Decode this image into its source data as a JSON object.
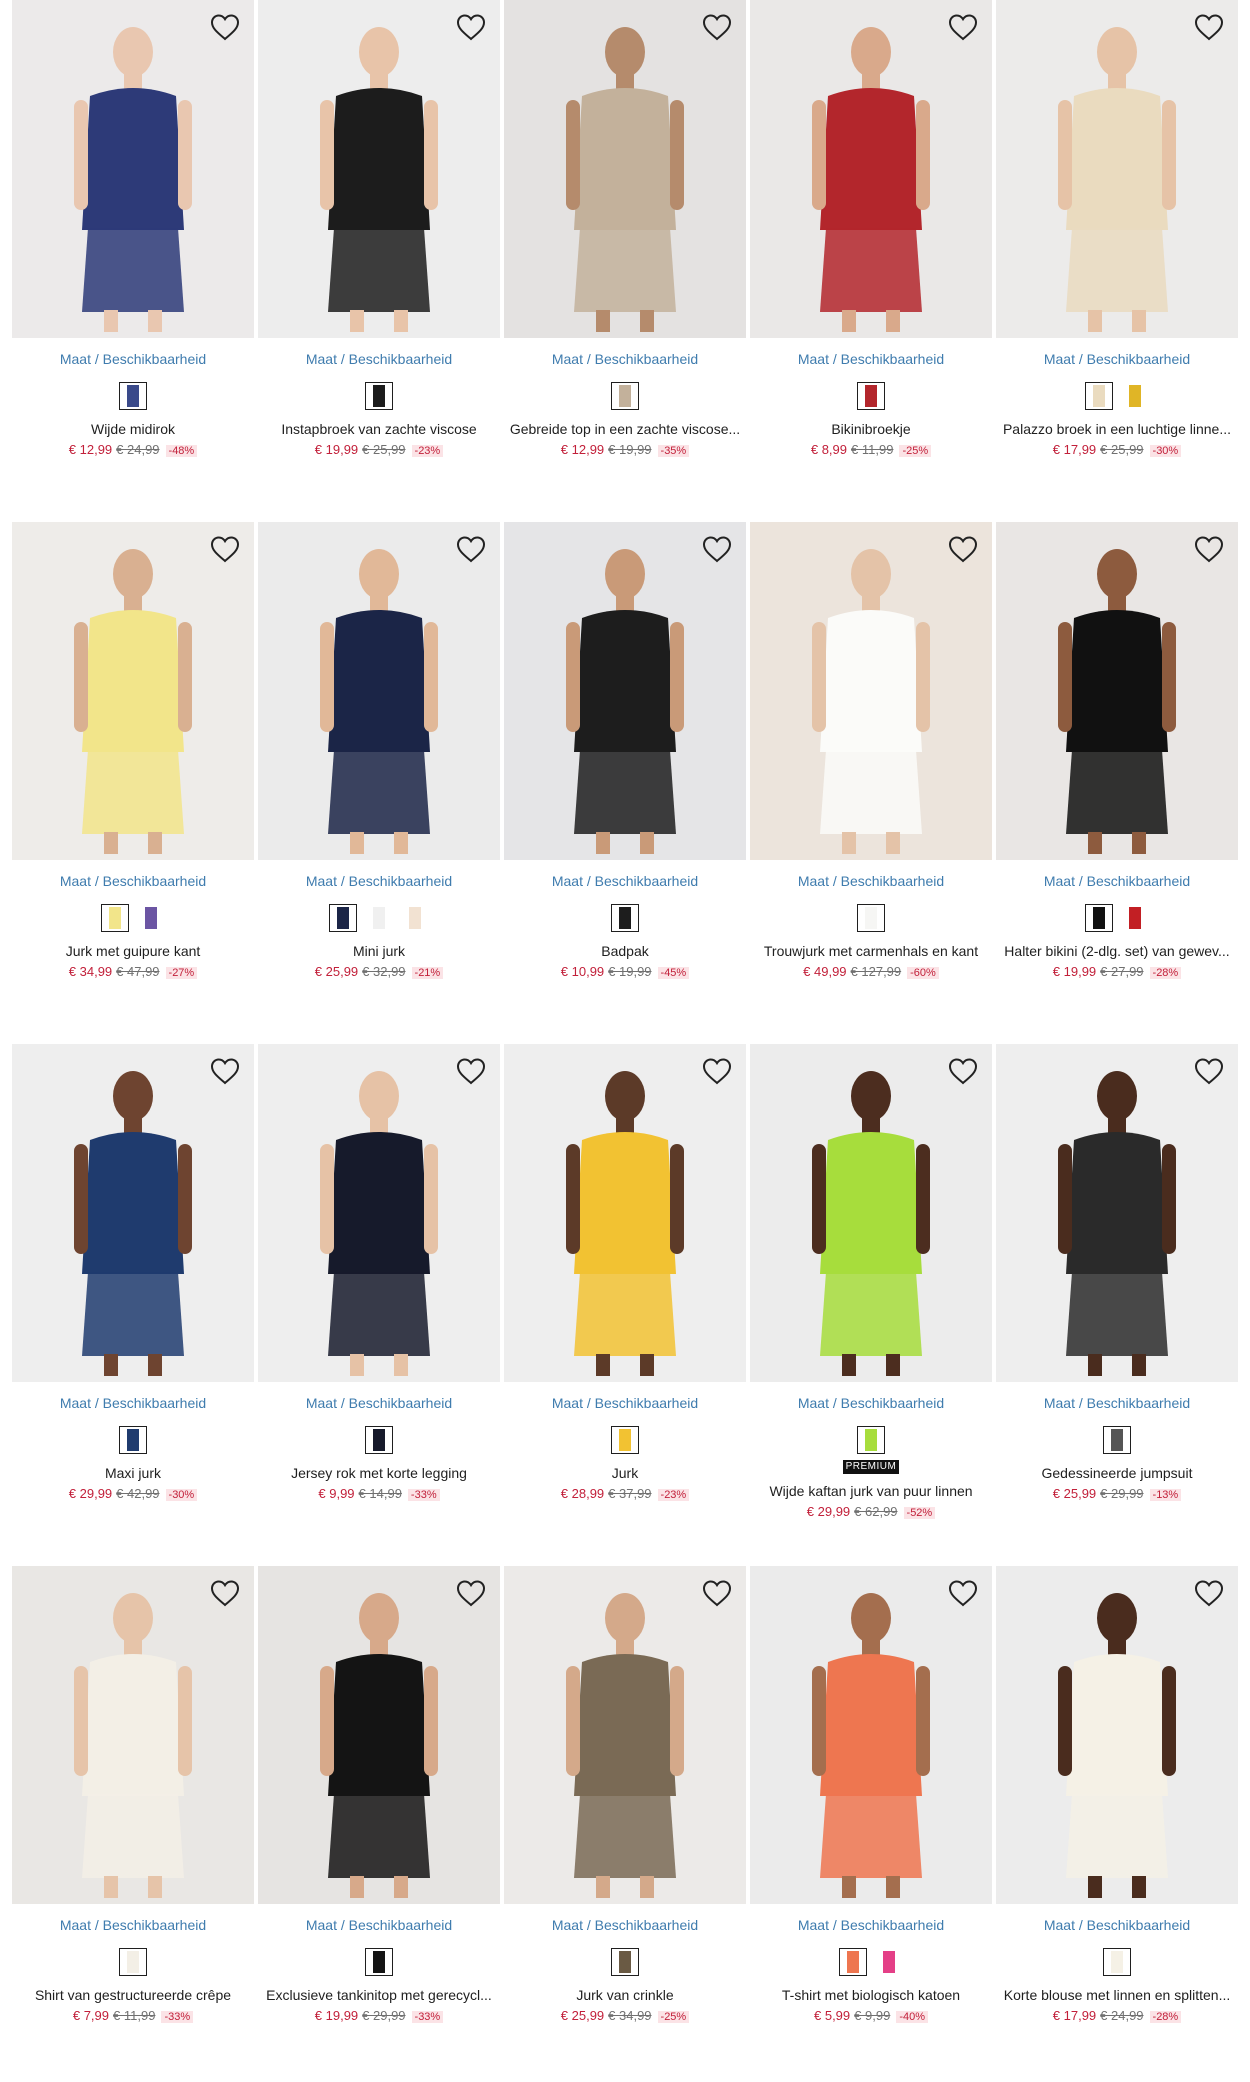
{
  "availability_label": "Maat / Beschikbaarheid",
  "premium_label": "PREMIUM",
  "products": [
    {
      "name": "Wijde midirok",
      "price": "€ 12,99",
      "old_price": "€ 24,99",
      "discount": "-48%",
      "bg": "#eceaea",
      "fig": "#2d3a78",
      "skin": "#e9c7b0",
      "swatches": [
        "#3a4a8a"
      ]
    },
    {
      "name": "Instapbroek van zachte viscose",
      "price": "€ 19,99",
      "old_price": "€ 25,99",
      "discount": "-23%",
      "bg": "#ededed",
      "fig": "#1c1c1c",
      "skin": "#e8c4a9",
      "swatches": [
        "#1c1c1c"
      ]
    },
    {
      "name": "Gebreide top in een zachte viscose...",
      "price": "€ 12,99",
      "old_price": "€ 19,99",
      "discount": "-35%",
      "bg": "#e4e2e1",
      "fig": "#c3b19b",
      "skin": "#b58b6c",
      "swatches": [
        "#c3b19b"
      ]
    },
    {
      "name": "Bikinibroekje",
      "price": "€ 8,99",
      "old_price": "€ 11,99",
      "discount": "-25%",
      "bg": "#eae8e7",
      "fig": "#b3262c",
      "skin": "#d9a98b",
      "swatches": [
        "#b3262c"
      ]
    },
    {
      "name": "Palazzo broek in een luchtige linne...",
      "price": "€ 17,99",
      "old_price": "€ 25,99",
      "discount": "-30%",
      "bg": "#ecebea",
      "fig": "#eadbbf",
      "skin": "#e6c3a7",
      "swatches": [
        "#eadbbf",
        "#e0b526"
      ]
    },
    {
      "name": "Jurk met guipure kant",
      "price": "€ 34,99",
      "old_price": "€ 47,99",
      "discount": "-27%",
      "bg": "#eeece9",
      "fig": "#f2e58a",
      "skin": "#d9b091",
      "swatches": [
        "#f2e58a",
        "#6b55a3"
      ]
    },
    {
      "name": "Mini jurk",
      "price": "€ 25,99",
      "old_price": "€ 32,99",
      "discount": "-21%",
      "bg": "#ebebeb",
      "fig": "#1b2547",
      "skin": "#e1b898",
      "swatches": [
        "#1b2547",
        "#f0f0f0",
        "#f2e2d2"
      ]
    },
    {
      "name": "Badpak",
      "price": "€ 10,99",
      "old_price": "€ 19,99",
      "discount": "-45%",
      "bg": "#e5e5e7",
      "fig": "#1d1d1d",
      "skin": "#c99a78",
      "swatches": [
        "#1d1d1d"
      ]
    },
    {
      "name": "Trouwjurk met carmenhals en kant",
      "price": "€ 49,99",
      "old_price": "€ 127,99",
      "discount": "-60%",
      "bg": "#ece4dc",
      "fig": "#fbfbf9",
      "skin": "#e4c3a8",
      "swatches": [
        "#f6f6f4"
      ]
    },
    {
      "name": "Halter bikini (2-dlg. set) van gewev...",
      "price": "€ 19,99",
      "old_price": "€ 27,99",
      "discount": "-28%",
      "bg": "#e9e6e4",
      "fig": "#111111",
      "skin": "#8d5b3e",
      "swatches": [
        "#111111",
        "#c21f24"
      ]
    },
    {
      "name": "Maxi jurk",
      "price": "€ 29,99",
      "old_price": "€ 42,99",
      "discount": "-30%",
      "bg": "#eeeeee",
      "fig": "#1f3b6e",
      "skin": "#6e4430",
      "swatches": [
        "#1f3b6e"
      ]
    },
    {
      "name": "Jersey rok met korte legging",
      "price": "€ 9,99",
      "old_price": "€ 14,99",
      "discount": "-33%",
      "bg": "#eeeeee",
      "fig": "#161a2b",
      "skin": "#e6c2a6",
      "swatches": [
        "#161a2b"
      ]
    },
    {
      "name": "Jurk",
      "price": "€ 28,99",
      "old_price": "€ 37,99",
      "discount": "-23%",
      "bg": "#eeeeee",
      "fig": "#f2c232",
      "skin": "#5c3a28",
      "swatches": [
        "#f2c232"
      ]
    },
    {
      "name": "Wijde kaftan jurk van puur linnen",
      "price": "€ 29,99",
      "old_price": "€ 62,99",
      "discount": "-52%",
      "bg": "#ececec",
      "fig": "#a7dd3c",
      "skin": "#4c2d1f",
      "swatches": [
        "#a7dd3c"
      ],
      "premium": true
    },
    {
      "name": "Gedessineerde jumpsuit",
      "price": "€ 25,99",
      "old_price": "€ 29,99",
      "discount": "-13%",
      "bg": "#eeeeee",
      "fig": "#2a2a2a",
      "skin": "#4a2c1e",
      "swatches": [
        "#555555"
      ]
    },
    {
      "name": "Shirt van gestructureerde crêpe",
      "price": "€ 7,99",
      "old_price": "€ 11,99",
      "discount": "-33%",
      "bg": "#e9e7e4",
      "fig": "#f3efe6",
      "skin": "#e6c4a9",
      "swatches": [
        "#f3efe6"
      ]
    },
    {
      "name": "Exclusieve tankinitop met gerecycl...",
      "price": "€ 19,99",
      "old_price": "€ 29,99",
      "discount": "-33%",
      "bg": "#e6e4e2",
      "fig": "#141414",
      "skin": "#d7a98a",
      "swatches": [
        "#141414"
      ]
    },
    {
      "name": "Jurk van crinkle",
      "price": "€ 25,99",
      "old_price": "€ 34,99",
      "discount": "-25%",
      "bg": "#eceae8",
      "fig": "#7a6a55",
      "skin": "#d4a98a",
      "swatches": [
        "#6a5a44"
      ]
    },
    {
      "name": "T-shirt met biologisch katoen",
      "price": "€ 5,99",
      "old_price": "€ 9,99",
      "discount": "-40%",
      "bg": "#ebebeb",
      "fig": "#ee7650",
      "skin": "#a46e4e",
      "swatches": [
        "#ee7650",
        "#e43f87"
      ]
    },
    {
      "name": "Korte blouse met linnen en splitten...",
      "price": "€ 17,99",
      "old_price": "€ 24,99",
      "discount": "-28%",
      "bg": "#ececec",
      "fig": "#f5f1e6",
      "skin": "#4a2c1e",
      "swatches": [
        "#f5f1e6"
      ]
    }
  ]
}
